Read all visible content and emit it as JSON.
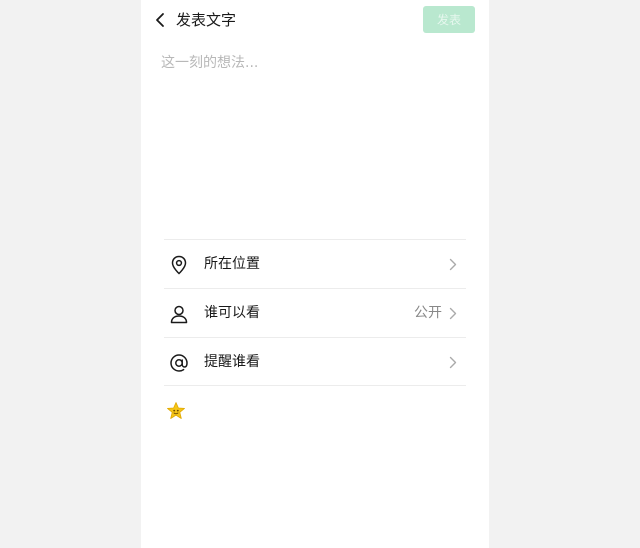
{
  "header": {
    "back_icon": "chevron-left-icon",
    "title": "发表文字",
    "publish_label": "发表",
    "publish_color": "#b9e8cf"
  },
  "composer": {
    "placeholder": "这一刻的想法..."
  },
  "options": [
    {
      "icon": "location-pin-icon",
      "label": "所在位置",
      "value": ""
    },
    {
      "icon": "person-icon",
      "label": "谁可以看",
      "value": "公开"
    },
    {
      "icon": "at-sign-icon",
      "label": "提醒谁看",
      "value": ""
    }
  ],
  "emoji": {
    "icon": "star-emoji-icon",
    "color": "#f5c518"
  }
}
